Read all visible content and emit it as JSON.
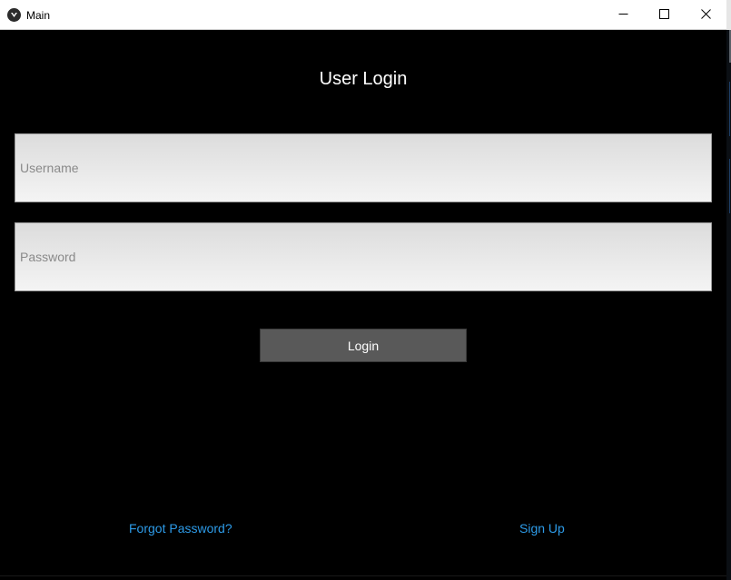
{
  "window": {
    "title": "Main",
    "app_icon": "kivy-logo-icon",
    "controls": {
      "minimize_icon": "minimize-icon",
      "maximize_icon": "maximize-icon",
      "close_icon": "close-icon"
    }
  },
  "login": {
    "heading": "User Login",
    "username": {
      "placeholder": "Username",
      "value": ""
    },
    "password": {
      "placeholder": "Password",
      "value": ""
    },
    "login_label": "Login"
  },
  "links": {
    "forgot_password": "Forgot Password?",
    "sign_up": "Sign Up"
  },
  "colors": {
    "background": "#000000",
    "link": "#2d9be8",
    "button": "#595959",
    "heading_text": "#ffffff"
  }
}
